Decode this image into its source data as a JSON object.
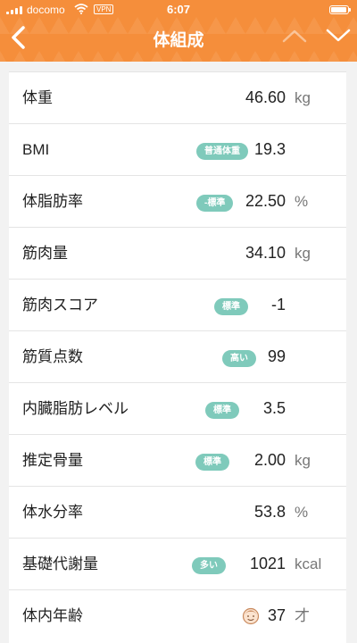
{
  "status_bar": {
    "carrier": "docomo",
    "vpn": "VPN",
    "time": "6:07"
  },
  "header": {
    "title": "体組成",
    "back_icon": "chevron-left-icon",
    "prev_icon": "chevron-up-icon",
    "next_icon": "chevron-down-icon"
  },
  "colors": {
    "header": "#f58e3b",
    "badge": "#7fcabb"
  },
  "rows": [
    {
      "label": "体重",
      "value": "46.60",
      "unit": "kg",
      "badge": ""
    },
    {
      "label": "BMI",
      "value": "19.3",
      "unit": "",
      "badge": "普通体重"
    },
    {
      "label": "体脂肪率",
      "value": "22.50",
      "unit": "%",
      "badge": "-標準"
    },
    {
      "label": "筋肉量",
      "value": "34.10",
      "unit": "kg",
      "badge": ""
    },
    {
      "label": "筋肉スコア",
      "value": "-1",
      "unit": "",
      "badge": "標準"
    },
    {
      "label": "筋質点数",
      "value": "99",
      "unit": "",
      "badge": "高い"
    },
    {
      "label": "内臓脂肪レベル",
      "value": "3.5",
      "unit": "",
      "badge": "標準"
    },
    {
      "label": "推定骨量",
      "value": "2.00",
      "unit": "kg",
      "badge": "標準"
    },
    {
      "label": "体水分率",
      "value": "53.8",
      "unit": "%",
      "badge": ""
    },
    {
      "label": "基礎代謝量",
      "value": "1021",
      "unit": "kcal",
      "badge": "多い"
    },
    {
      "label": "体内年齢",
      "value": "37",
      "unit": "才",
      "badge": "",
      "icon": "face-icon"
    }
  ]
}
